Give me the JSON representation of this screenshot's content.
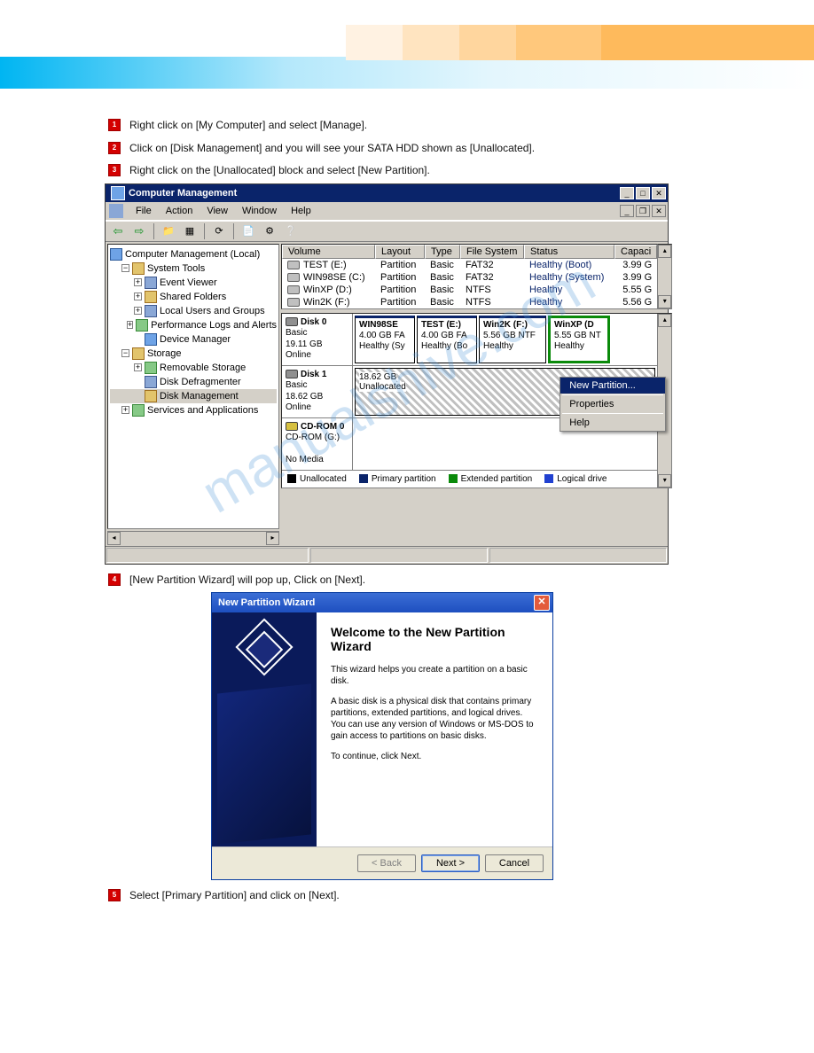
{
  "steps": {
    "s1": {
      "num": "1",
      "text": "Right click on [My Computer] and select [Manage]."
    },
    "s2": {
      "num": "2",
      "text": "Click on [Disk Management] and you will see your SATA HDD shown as [Unallocated]."
    },
    "s3": {
      "num": "3",
      "text": "Right click on the [Unallocated] block and select [New Partition]."
    },
    "s4": {
      "num": "4",
      "text": "[New Partition Wizard] will pop up, Click on [Next]."
    },
    "s5": {
      "num": "5",
      "text": "Select [Primary Partition] and click on [Next]."
    }
  },
  "cm": {
    "title": "Computer Management",
    "menus": {
      "file": "File",
      "action": "Action",
      "view": "View",
      "window": "Window",
      "help": "Help"
    },
    "tree": {
      "root": "Computer Management (Local)",
      "systools": "System Tools",
      "eventViewer": "Event Viewer",
      "sharedFolders": "Shared Folders",
      "localUsers": "Local Users and Groups",
      "perf": "Performance Logs and Alerts",
      "devmgr": "Device Manager",
      "storage": "Storage",
      "removable": "Removable Storage",
      "defrag": "Disk Defragmenter",
      "diskmgmt": "Disk Management",
      "services": "Services and Applications"
    },
    "list": {
      "headers": {
        "volume": "Volume",
        "layout": "Layout",
        "type": "Type",
        "fs": "File System",
        "status": "Status",
        "capacity": "Capaci"
      },
      "rows": [
        {
          "vol": "TEST (E:)",
          "layout": "Partition",
          "type": "Basic",
          "fs": "FAT32",
          "status": "Healthy (Boot)",
          "cap": "3.99 G"
        },
        {
          "vol": "WIN98SE (C:)",
          "layout": "Partition",
          "type": "Basic",
          "fs": "FAT32",
          "status": "Healthy (System)",
          "cap": "3.99 G"
        },
        {
          "vol": "WinXP (D:)",
          "layout": "Partition",
          "type": "Basic",
          "fs": "NTFS",
          "status": "Healthy",
          "cap": "5.55 G"
        },
        {
          "vol": "Win2K (F:)",
          "layout": "Partition",
          "type": "Basic",
          "fs": "NTFS",
          "status": "Healthy",
          "cap": "5.56 G"
        }
      ]
    },
    "disks": {
      "d0": {
        "name": "Disk 0",
        "type": "Basic",
        "size": "19.11 GB",
        "state": "Online"
      },
      "d0parts": [
        {
          "name": "WIN98SE",
          "line2": "4.00 GB FA",
          "line3": "Healthy (Sy"
        },
        {
          "name": "TEST (E:)",
          "line2": "4.00 GB FA",
          "line3": "Healthy (Bo"
        },
        {
          "name": "Win2K (F:)",
          "line2": "5.56 GB NTF",
          "line3": "Healthy"
        },
        {
          "name": "WinXP (D",
          "line2": "5.55 GB NT",
          "line3": "Healthy"
        }
      ],
      "d1": {
        "name": "Disk 1",
        "type": "Basic",
        "size": "18.62 GB",
        "state": "Online"
      },
      "d1unalloc": {
        "size": "18.62 GB",
        "label": "Unallocated"
      },
      "cd": {
        "name": "CD-ROM 0",
        "type": "CD-ROM (G:)",
        "state": "No Media"
      }
    },
    "ctx": {
      "newpart": "New Partition...",
      "props": "Properties",
      "help": "Help"
    },
    "legend": {
      "unalloc": "Unallocated",
      "primary": "Primary partition",
      "ext": "Extended partition",
      "logical": "Logical drive"
    }
  },
  "wizard": {
    "title": "New Partition Wizard",
    "heading": "Welcome to the New Partition Wizard",
    "p1": "This wizard helps you create a partition on a basic disk.",
    "p2": "A basic disk is a physical disk that contains primary partitions, extended partitions, and logical drives. You can use any version of Windows or MS-DOS to gain access to partitions on basic disks.",
    "p3": "To continue, click Next.",
    "btn_back": "< Back",
    "btn_next": "Next >",
    "btn_cancel": "Cancel"
  },
  "watermark": "manualshive.com"
}
